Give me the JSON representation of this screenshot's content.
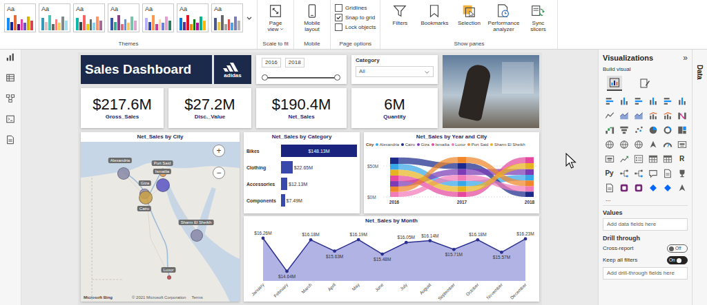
{
  "ribbon": {
    "themes": {
      "label": "Themes",
      "items": [
        {
          "label": "Aa",
          "colors": [
            "#118DFF",
            "#12239E",
            "#E66C37",
            "#6B007B",
            "#E044A7",
            "#744EC2",
            "#D9B300",
            "#D64550"
          ]
        },
        {
          "label": "Aa",
          "colors": [
            "#3599B8",
            "#DFBFBF",
            "#4AC5BB",
            "#5F6B6D",
            "#FB8281",
            "#F4D25A",
            "#7F898A",
            "#A4DDEE"
          ]
        },
        {
          "label": "Aa",
          "colors": [
            "#01B8AA",
            "#374649",
            "#FD625E",
            "#F2C80F",
            "#5F6B6D",
            "#8AD4EB",
            "#FE9666",
            "#A66999"
          ]
        },
        {
          "label": "Aa",
          "colors": [
            "#3257A8",
            "#37A794",
            "#8B3D88",
            "#DD6B7F",
            "#6B91C9",
            "#F5C869",
            "#77C4A8",
            "#DEA6CF"
          ]
        },
        {
          "label": "Aa",
          "colors": [
            "#B6B0FF",
            "#3049AD",
            "#FF994E",
            "#C83D95",
            "#FFD5B9",
            "#6F7FE0",
            "#E3A0D1",
            "#2C7A60"
          ]
        },
        {
          "label": "Aa",
          "colors": [
            "#0078D4",
            "#5C2D91",
            "#E81123",
            "#FF8C00",
            "#107C10",
            "#B4009E",
            "#00B294",
            "#FFB900"
          ]
        },
        {
          "label": "Aa",
          "colors": [
            "#4A588A",
            "#ECC846",
            "#66666D",
            "#A3A3A3",
            "#E34A4A",
            "#4DA4E6",
            "#7A7FB5",
            "#B5B5B5"
          ]
        }
      ]
    },
    "scale_to_fit": {
      "button": "Page view",
      "label": "Scale to fit"
    },
    "mobile": {
      "button": "Mobile layout",
      "label": "Mobile"
    },
    "page_options": {
      "label": "Page options",
      "items": [
        {
          "label": "Gridlines",
          "checked": false
        },
        {
          "label": "Snap to grid",
          "checked": true
        },
        {
          "label": "Lock objects",
          "checked": false
        }
      ]
    },
    "show_panes": {
      "label": "Show panes",
      "items": [
        {
          "label": "Filters",
          "kind": "filter"
        },
        {
          "label": "Bookmarks",
          "kind": "bookmark"
        },
        {
          "label": "Selection",
          "kind": "selection"
        },
        {
          "label": "Performance analyzer",
          "kind": "performance"
        },
        {
          "label": "Sync slicers",
          "kind": "sync"
        }
      ]
    }
  },
  "nav_rail": [
    {
      "kind": "report"
    },
    {
      "kind": "table"
    },
    {
      "kind": "model"
    },
    {
      "kind": "dax"
    },
    {
      "kind": "tmdl"
    }
  ],
  "report": {
    "title": "Sales Dashboard",
    "logo": "adidas",
    "year_slider": {
      "from": "2016",
      "to": "2018",
      "low_level": 0,
      "high_level": 1
    },
    "category_filter": {
      "label": "Category",
      "value": "All"
    },
    "kpis": [
      {
        "value": "$217.6M",
        "label": "Gross_Sales"
      },
      {
        "value": "$27.2M",
        "label": "Disc._Value"
      },
      {
        "value": "$190.4M",
        "label": "Net_Sales"
      },
      {
        "value": "6M",
        "label": "Quantity"
      }
    ],
    "map": {
      "title": "Net_Sales by City",
      "zoom_in": "+",
      "zoom_out": "−",
      "attribution": "Microsoft Bing",
      "copyright": "© 2021 Microsoft Corporation",
      "terms": "Terms",
      "cities": [
        {
          "name": "Alexandria",
          "level": 0.7,
          "color": "#8a89a8"
        },
        {
          "name": "Port Said",
          "level": 0.2,
          "color": "#e39a4c"
        },
        {
          "name": "Ismailia",
          "level": 0.8,
          "color": "#5b56c4"
        },
        {
          "name": "Giza",
          "level": 0.5,
          "color": "#9d97b8"
        },
        {
          "name": "Cairo",
          "level": 0.8,
          "color": "#c9a043"
        },
        {
          "name": "Sharm El Sheikh",
          "level": 0.7,
          "color": "#8a89a8"
        },
        {
          "name": "Luxor",
          "level": 0.05,
          "color": "#d0413b"
        }
      ]
    },
    "category_chart": {
      "title": "Net_Sales by Category",
      "bars": [
        {
          "label": "Bikes",
          "value": 148.13,
          "text": "$148.13M"
        },
        {
          "label": "Clothing",
          "value": 22.65,
          "text": "$22.65M"
        },
        {
          "label": "Accessories",
          "value": 12.13,
          "text": "$12.13M"
        },
        {
          "label": "Components",
          "value": 7.49,
          "text": "$7.49M"
        }
      ]
    },
    "ribbon_chart": {
      "title": "Net_Sales by Year and City",
      "legend_title": "City",
      "years": [
        "2016",
        "2017",
        "2018"
      ],
      "ticks": [
        {
          "label": "$50M",
          "value": 50
        },
        {
          "label": "$0M",
          "value": 0
        }
      ],
      "series": [
        {
          "name": "Alexandria",
          "color": "#38a8e8",
          "values": [
            9.5,
            8.9,
            9.1
          ]
        },
        {
          "name": "Cairo",
          "color": "#1c2a8c",
          "values": [
            10.2,
            9.8,
            8.6
          ]
        },
        {
          "name": "Giza",
          "color": "#7d3cb5",
          "values": [
            8.8,
            9.6,
            9.4
          ]
        },
        {
          "name": "Ismailia",
          "color": "#e5489e",
          "values": [
            9.0,
            8.4,
            9.7
          ]
        },
        {
          "name": "Luxor",
          "color": "#f27ab8",
          "values": [
            8.1,
            9.2,
            8.8
          ]
        },
        {
          "name": "Port Said",
          "color": "#f0872a",
          "values": [
            8.6,
            9.9,
            9.0
          ]
        },
        {
          "name": "Sharm El Sheikh",
          "color": "#e6b422",
          "values": [
            9.3,
            8.7,
            9.5
          ]
        }
      ]
    },
    "line_chart": {
      "title": "Net_Sales by Month",
      "points": [
        {
          "month": "January",
          "value": 16.26,
          "label": "$16.26M"
        },
        {
          "month": "February",
          "value": 14.64,
          "label": "$14.64M"
        },
        {
          "month": "March",
          "value": 16.18,
          "label": "$16.18M"
        },
        {
          "month": "April",
          "value": 15.63,
          "label": "$15.63M"
        },
        {
          "month": "May",
          "value": 16.19,
          "label": "$16.19M"
        },
        {
          "month": "June",
          "value": 15.48,
          "label": "$15.48M"
        },
        {
          "month": "July",
          "value": 16.05,
          "label": "$16.05M"
        },
        {
          "month": "August",
          "value": 16.14,
          "label": "$16.14M"
        },
        {
          "month": "September",
          "value": 15.71,
          "label": "$15.71M"
        },
        {
          "month": "October",
          "value": 16.18,
          "label": "$16.18M"
        },
        {
          "month": "November",
          "value": 15.57,
          "label": "$15.57M"
        },
        {
          "month": "December",
          "value": 16.23,
          "label": "$16.23M"
        }
      ]
    }
  },
  "visualizations_pane": {
    "title": "Visualizations",
    "collapse": "»",
    "build_label": "Build visual",
    "build_modes": [
      {
        "kind": "build",
        "selected": true
      },
      {
        "kind": "format",
        "selected": false
      }
    ],
    "gallery": [
      {
        "kind": "bar"
      },
      {
        "kind": "column"
      },
      {
        "kind": "bar"
      },
      {
        "kind": "column"
      },
      {
        "kind": "bar"
      },
      {
        "kind": "column"
      },
      {
        "kind": "line"
      },
      {
        "kind": "area"
      },
      {
        "kind": "area"
      },
      {
        "kind": "combo"
      },
      {
        "kind": "combo"
      },
      {
        "kind": "ribbon"
      },
      {
        "kind": "waterfall"
      },
      {
        "kind": "funnel"
      },
      {
        "kind": "scatter"
      },
      {
        "kind": "pie"
      },
      {
        "kind": "donut"
      },
      {
        "kind": "treemap"
      },
      {
        "kind": "map"
      },
      {
        "kind": "map"
      },
      {
        "kind": "map"
      },
      {
        "kind": "arrow"
      },
      {
        "kind": "gauge"
      },
      {
        "kind": "card"
      },
      {
        "kind": "card"
      },
      {
        "kind": "kpi"
      },
      {
        "kind": "slicer"
      },
      {
        "kind": "table"
      },
      {
        "kind": "table"
      },
      {
        "kind": "glyph",
        "text": "R"
      },
      {
        "kind": "glyph",
        "text": "Py"
      },
      {
        "kind": "tree"
      },
      {
        "kind": "tree"
      },
      {
        "kind": "chat"
      },
      {
        "kind": "doc"
      },
      {
        "kind": "trophy"
      },
      {
        "kind": "doc"
      },
      {
        "kind": "app"
      },
      {
        "kind": "app"
      },
      {
        "kind": "diamond"
      },
      {
        "kind": "diamond"
      },
      {
        "kind": "arrow"
      }
    ],
    "more": "...",
    "values": {
      "label": "Values",
      "placeholder": "Add data fields here"
    },
    "drill_through": {
      "label": "Drill through",
      "toggles": [
        {
          "label": "Cross-report",
          "text": "Off",
          "on": false
        },
        {
          "label": "Keep all filters",
          "text": "On",
          "on": true
        }
      ],
      "placeholder": "Add drill-through fields here"
    }
  },
  "data_pane": {
    "label": "Data"
  }
}
